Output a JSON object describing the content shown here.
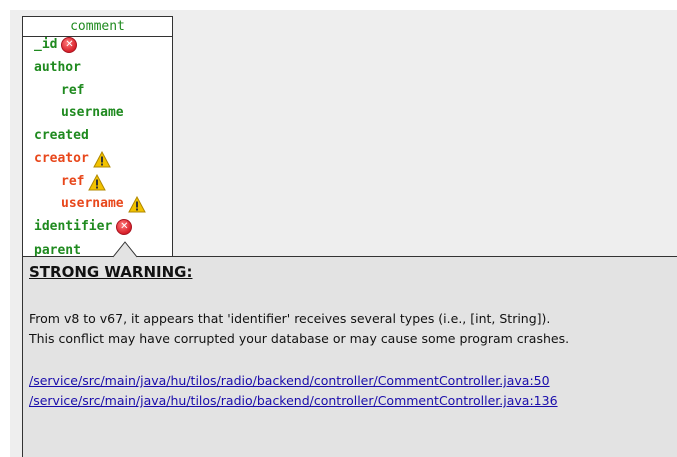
{
  "entity": {
    "title": "comment",
    "fields": [
      {
        "name": "_id",
        "status": "error"
      },
      {
        "name": "author",
        "status": "ok"
      },
      {
        "name": "ref",
        "status": "ok"
      },
      {
        "name": "username",
        "status": "ok"
      },
      {
        "name": "created",
        "status": "ok"
      },
      {
        "name": "creator",
        "status": "warning"
      },
      {
        "name": "ref",
        "status": "warning"
      },
      {
        "name": "username",
        "status": "warning"
      },
      {
        "name": "identifier",
        "status": "error"
      },
      {
        "name": "parent",
        "status": "ok"
      }
    ]
  },
  "tooltip": {
    "title": "STRONG WARNING:",
    "message_lines": [
      "From v8 to v67, it appears that 'identifier' receives several types (i.e., [int, String]).",
      "This conflict may have corrupted your database or may cause some program crashes."
    ],
    "links": [
      "/service/src/main/java/hu/tilos/radio/backend/controller/CommentController.java:50",
      "/service/src/main/java/hu/tilos/radio/backend/controller/CommentController.java:136"
    ]
  },
  "colors": {
    "ok_field": "#1f8a1f",
    "warning_field": "#e8471b",
    "error_icon": "#d8202a",
    "warning_icon": "#f2c200",
    "link": "#1a0dab",
    "tooltip_bg": "#e3e3e3"
  },
  "icons": {
    "error": "error-circle-x-icon",
    "warning": "warning-triangle-icon"
  }
}
